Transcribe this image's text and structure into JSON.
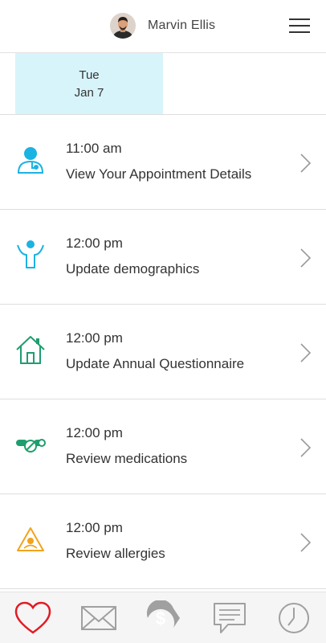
{
  "header": {
    "user_name": "Marvin Ellis",
    "avatar_icon": "user-avatar",
    "menu_icon": "hamburger-menu-icon"
  },
  "date_strip": {
    "selected": {
      "weekday": "Tue",
      "date": "Jan 7"
    }
  },
  "appointments": [
    {
      "time": "11:00 am",
      "title": "View Your Appointment Details",
      "icon": "doctor-icon",
      "color": "#1bb3e2"
    },
    {
      "time": "12:00 pm",
      "title": "Update demographics",
      "icon": "person-arms-up-icon",
      "color": "#1bb3e2"
    },
    {
      "time": "12:00 pm",
      "title": "Update Annual Questionnaire",
      "icon": "house-icon",
      "color": "#1e9e6e"
    },
    {
      "time": "12:00 pm",
      "title": "Review medications",
      "icon": "pills-icon",
      "color": "#1e9e6e"
    },
    {
      "time": "12:00 pm",
      "title": "Review allergies",
      "icon": "allergy-warning-icon",
      "color": "#f0a41c"
    }
  ],
  "tabbar": {
    "tabs": [
      {
        "icon": "heart-icon",
        "active": true,
        "color": "#e21b23"
      },
      {
        "icon": "mail-icon",
        "active": false,
        "color": "#a0a0a0"
      },
      {
        "icon": "billing-dollar-icon",
        "active": false,
        "color": "#a0a0a0"
      },
      {
        "icon": "chat-icon",
        "active": false,
        "color": "#a0a0a0"
      },
      {
        "icon": "clock-icon",
        "active": false,
        "color": "#a0a0a0"
      }
    ]
  }
}
